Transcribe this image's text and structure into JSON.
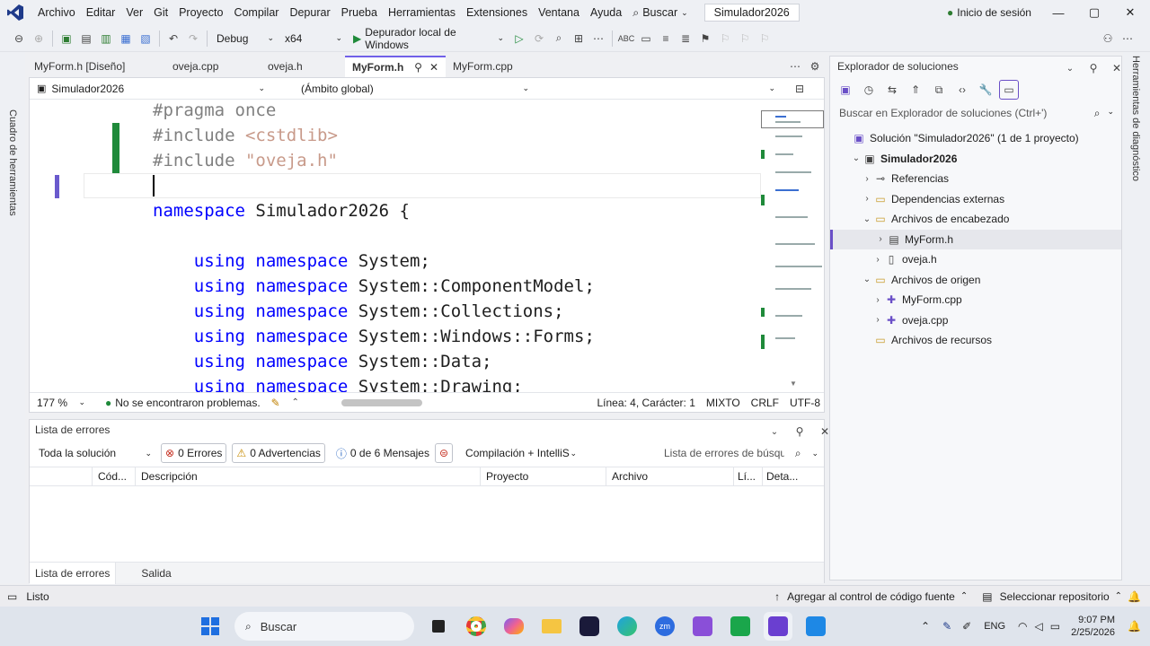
{
  "menu": {
    "items": [
      "Archivo",
      "Editar",
      "Ver",
      "Git",
      "Proyecto",
      "Compilar",
      "Depurar",
      "Prueba",
      "Herramientas",
      "Extensiones",
      "Ventana",
      "Ayuda"
    ],
    "search_label": "Buscar",
    "solution_title": "Simulador2026",
    "signin_label": "Inicio de sesión"
  },
  "toolbar": {
    "config": "Debug",
    "platform": "x64",
    "debugger": "Depurador local de Windows"
  },
  "left_tab": "Cuadro de herramientas",
  "right_tab": "Herramientas de diagnóstico",
  "doc_tabs": [
    "MyForm.h [Diseño]",
    "oveja.cpp",
    "oveja.h",
    "MyForm.h",
    "MyForm.cpp"
  ],
  "nav": {
    "project": "Simulador2026",
    "scope": "(Ámbito global)",
    "member": ""
  },
  "code_lines": [
    {
      "parts": [
        [
          "pp",
          "#pragma once"
        ]
      ]
    },
    {
      "parts": [
        [
          "pp",
          "#include "
        ],
        [
          "str",
          "<cstdlib>"
        ]
      ]
    },
    {
      "parts": [
        [
          "pp",
          "#include "
        ],
        [
          "str",
          "\"oveja.h\""
        ]
      ]
    },
    {
      "parts": []
    },
    {
      "parts": [
        [
          "kw",
          "namespace "
        ],
        [
          "id",
          "Simulador2026 {"
        ]
      ]
    },
    {
      "parts": []
    },
    {
      "parts": [
        [
          "kw",
          "    using namespace "
        ],
        [
          "id",
          "System;"
        ]
      ]
    },
    {
      "parts": [
        [
          "kw",
          "    using namespace "
        ],
        [
          "id",
          "System::ComponentModel;"
        ]
      ]
    },
    {
      "parts": [
        [
          "kw",
          "    using namespace "
        ],
        [
          "id",
          "System::Collections;"
        ]
      ]
    },
    {
      "parts": [
        [
          "kw",
          "    using namespace "
        ],
        [
          "id",
          "System::Windows::Forms;"
        ]
      ]
    },
    {
      "parts": [
        [
          "kw",
          "    using namespace "
        ],
        [
          "id",
          "System::Data;"
        ]
      ]
    },
    {
      "parts": [
        [
          "kw",
          "    using namespace "
        ],
        [
          "id",
          "System::Drawing;"
        ]
      ]
    }
  ],
  "editor_status": {
    "zoom": "177 %",
    "problems": "No se encontraron problemas.",
    "position": "Línea: 4, Carácter: 1",
    "mode": "MIXTO",
    "eol": "CRLF",
    "encoding": "UTF-8"
  },
  "errors": {
    "title": "Lista de errores",
    "scope": "Toda la solución",
    "errors_label": "0 Errores",
    "warnings_label": "0 Advertencias",
    "messages_label": "0 de 6 Mensajes",
    "build_filter": "Compilación + IntelliS",
    "search_placeholder": "Lista de errores de búsqued",
    "columns": [
      "Cód...",
      "Descripción",
      "Proyecto",
      "Archivo",
      "Lí...",
      "Deta..."
    ],
    "tabs": [
      "Lista de errores",
      "Salida"
    ]
  },
  "solution_explorer": {
    "title": "Explorador de soluciones",
    "search_placeholder": "Buscar en Explorador de soluciones (Ctrl+')",
    "tree": [
      {
        "label": "Solución \"Simulador2026\"  (1 de 1 proyecto)",
        "indent": 0,
        "chev": "",
        "icon": "solution"
      },
      {
        "label": "Simulador2026",
        "indent": 1,
        "chev": "⌄",
        "icon": "project",
        "bold": true
      },
      {
        "label": "Referencias",
        "indent": 2,
        "chev": "›",
        "icon": "references"
      },
      {
        "label": "Dependencias externas",
        "indent": 2,
        "chev": "›",
        "icon": "folder"
      },
      {
        "label": "Archivos de encabezado",
        "indent": 2,
        "chev": "⌄",
        "icon": "folder"
      },
      {
        "label": "MyForm.h",
        "indent": 3,
        "chev": "›",
        "icon": "form",
        "selected": true
      },
      {
        "label": "oveja.h",
        "indent": 3,
        "chev": "›",
        "icon": "header"
      },
      {
        "label": "Archivos de origen",
        "indent": 2,
        "chev": "⌄",
        "icon": "folder"
      },
      {
        "label": "MyForm.cpp",
        "indent": 3,
        "chev": "›",
        "icon": "cpp"
      },
      {
        "label": "oveja.cpp",
        "indent": 3,
        "chev": "›",
        "icon": "cpp"
      },
      {
        "label": "Archivos de recursos",
        "indent": 2,
        "chev": "",
        "icon": "folder"
      }
    ]
  },
  "statusbar": {
    "ready": "Listo",
    "source_control": "Agregar al control de código fuente",
    "repo": "Seleccionar repositorio"
  },
  "taskbar": {
    "search": "Buscar",
    "lang": "ENG",
    "time": "9:07 PM",
    "date": "2/25/2026"
  }
}
